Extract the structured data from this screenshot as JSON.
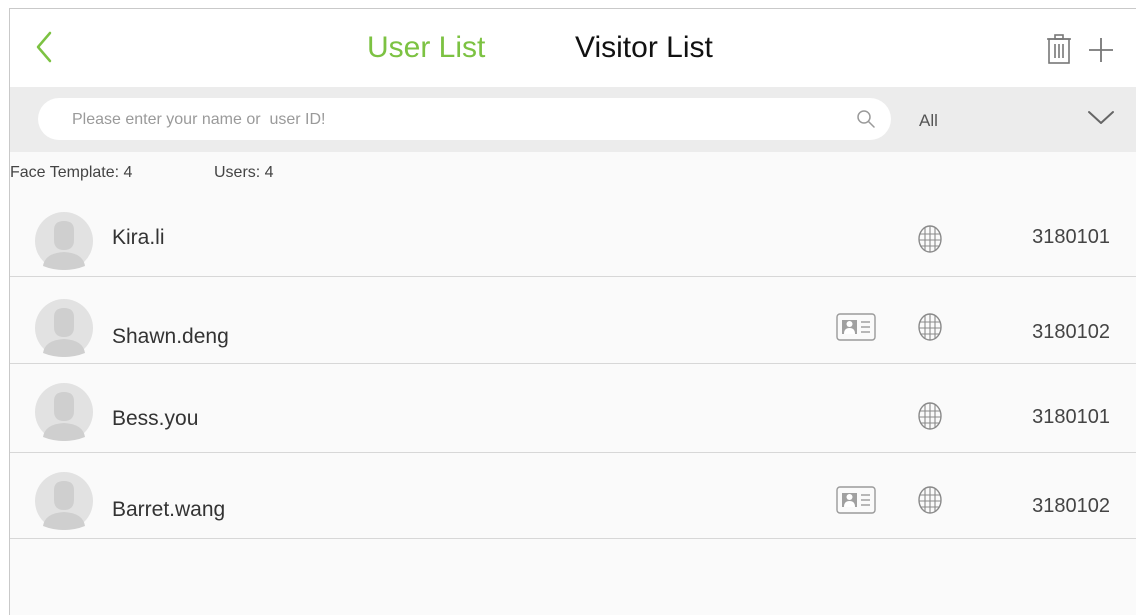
{
  "header": {
    "tabs": [
      "User List",
      "Visitor List"
    ],
    "active_tab": "User List",
    "icons": [
      "back-icon",
      "trash-icon",
      "plus-icon"
    ]
  },
  "search": {
    "placeholder": "Please enter your name or  user ID!",
    "filter_value": "All"
  },
  "summary": {
    "face_template": "Face Template: 4",
    "users": "Users: 4"
  },
  "users": [
    {
      "name": "Kira.li",
      "id": "3180101",
      "has_card": false,
      "has_face": true
    },
    {
      "name": "Shawn.deng",
      "id": "3180102",
      "has_card": true,
      "has_face": true
    },
    {
      "name": "Bess.you",
      "id": "3180101",
      "has_card": false,
      "has_face": true
    },
    {
      "name": "Barret.wang",
      "id": "3180102",
      "has_card": true,
      "has_face": true
    }
  ],
  "colors": {
    "accent": "#7cc242",
    "searchbar_bg": "#ececec",
    "divider": "#d7d7d7",
    "icon_gray": "#9a9a9a"
  }
}
